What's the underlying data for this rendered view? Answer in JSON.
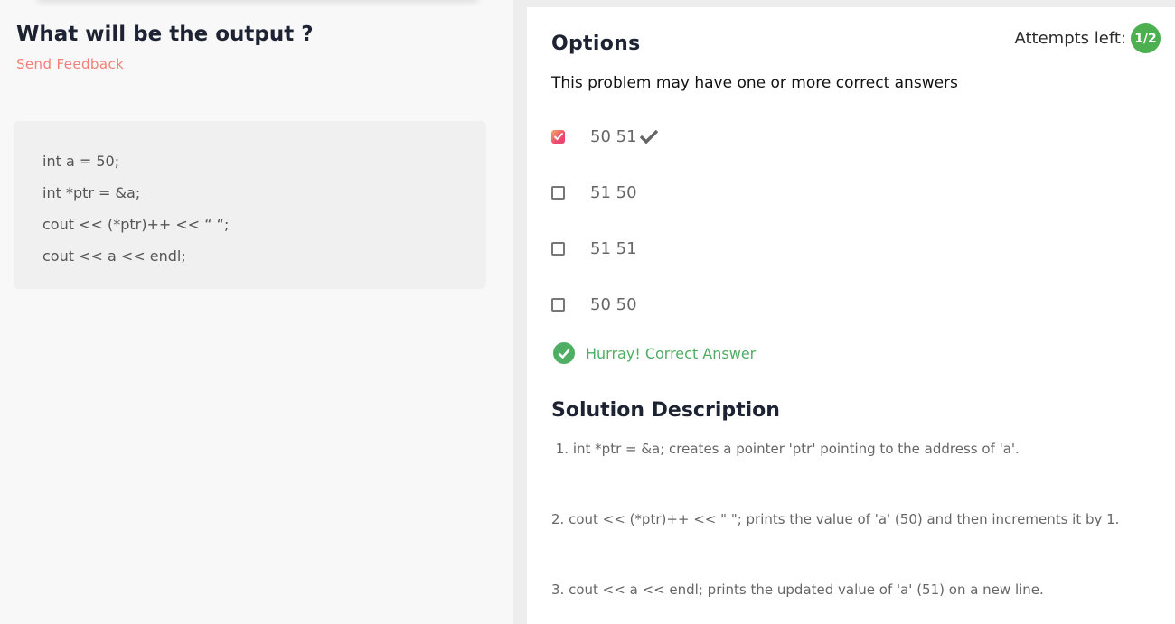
{
  "question": {
    "title": "What will be the output ?",
    "feedback_link": "Send Feedback",
    "code": [
      "int a = 50;",
      "int *ptr = &a;",
      "cout << (*ptr)++ << “ “;",
      "cout << a << endl;"
    ]
  },
  "options_panel": {
    "title": "Options",
    "attempts_label": "Attempts left:",
    "attempts_value": "1/2",
    "instruction": "This problem may have one or more correct answers",
    "options": [
      {
        "label": "50 51",
        "checked": true,
        "correct": true
      },
      {
        "label": "51 50",
        "checked": false
      },
      {
        "label": "51 51",
        "checked": false
      },
      {
        "label": "50 50",
        "checked": false
      }
    ],
    "result_text": "Hurray! Correct Answer",
    "colors": {
      "success": "#4fae63",
      "badge": "#4caf50",
      "feedback": "#f47f76"
    }
  },
  "solution": {
    "title": "Solution Description",
    "lines": [
      " 1. int *ptr = &a; creates a pointer 'ptr' pointing to the address of 'a'.",
      "2. cout << (*ptr)++ << \" \"; prints the value of 'a' (50) and then increments it by 1.",
      "3. cout << a << endl; prints the updated value of 'a' (51) on a new line."
    ]
  }
}
